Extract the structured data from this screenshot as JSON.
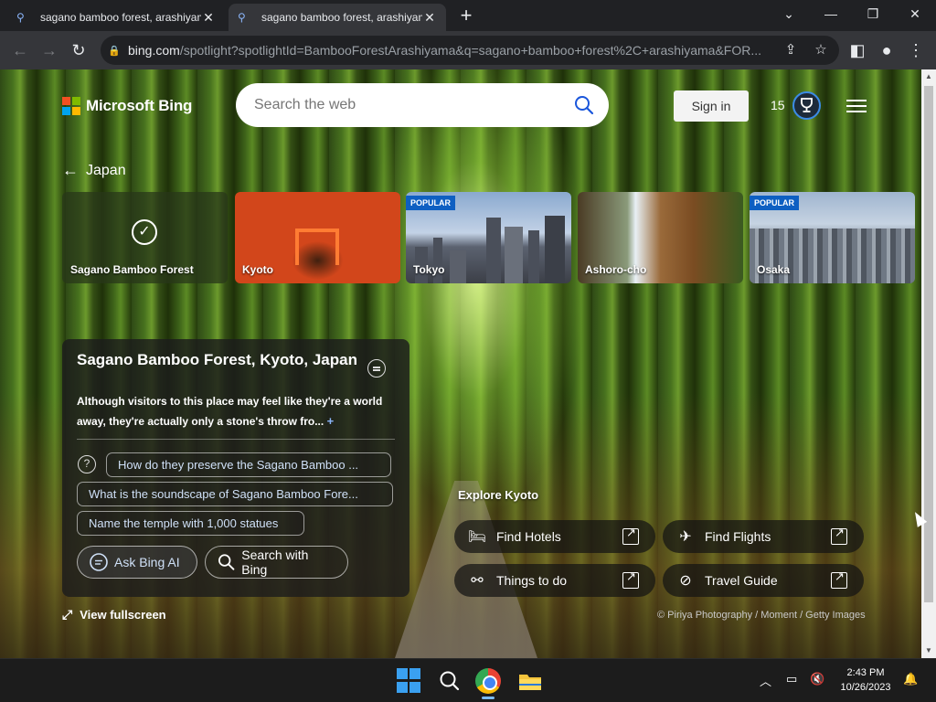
{
  "browser": {
    "tabs": [
      {
        "title": "sagano bamboo forest, arashiyam",
        "active": false
      },
      {
        "title": "sagano bamboo forest, arashiyam",
        "active": true
      }
    ],
    "new_tab": "+",
    "window_controls": {
      "dropdown": "⌄",
      "minimize": "—",
      "restore": "❐",
      "close": "✕"
    },
    "url_host": "bing.com",
    "url_path": "/spotlight?spotlightId=BambooForestArashiyama&q=sagano+bamboo+forest%2C+arashiyama&FOR..."
  },
  "header": {
    "logo_text": "Microsoft Bing",
    "logo_colors": [
      "#f25022",
      "#7fba00",
      "#00a4ef",
      "#ffb900"
    ],
    "search_placeholder": "Search the web",
    "sign_in": "Sign in",
    "rewards_count": "15"
  },
  "breadcrumb": {
    "back_label": "Japan"
  },
  "cards": [
    {
      "label": "Sagano Bamboo Forest",
      "badge": "",
      "selected": true
    },
    {
      "label": "Kyoto",
      "badge": ""
    },
    {
      "label": "Tokyo",
      "badge": "POPULAR"
    },
    {
      "label": "Ashoro-cho",
      "badge": ""
    },
    {
      "label": "Osaka",
      "badge": "POPULAR"
    }
  ],
  "info": {
    "title": "Sagano Bamboo Forest, Kyoto, Japan",
    "description": "Although visitors to this place may feel like they're a world away, they're actually only a stone's throw fro...",
    "more": "+",
    "questions": [
      "How do they preserve the Sagano Bamboo ...",
      "What is the soundscape of Sagano Bamboo Fore...",
      "Name the temple with 1,000 statues"
    ],
    "ask_ai": "Ask Bing AI",
    "search_bing": "Search with Bing"
  },
  "view_fullscreen": "View fullscreen",
  "explore": {
    "title": "Explore Kyoto",
    "links": [
      {
        "label": "Find Hotels",
        "icon": "bed-icon"
      },
      {
        "label": "Find Flights",
        "icon": "plane-icon"
      },
      {
        "label": "Things to do",
        "icon": "binoculars-icon"
      },
      {
        "label": "Travel Guide",
        "icon": "compass-icon"
      }
    ]
  },
  "credit": "© Piriya Photography / Moment / Getty Images",
  "taskbar": {
    "time": "2:43 PM",
    "date": "10/26/2023"
  }
}
